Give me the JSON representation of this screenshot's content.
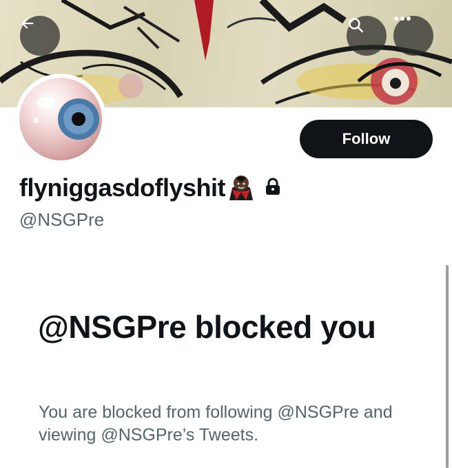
{
  "header": {
    "back_icon": "arrow-left-icon",
    "search_icon": "search-icon",
    "more_icon": "more-horizontal-icon"
  },
  "profile": {
    "follow_label": "Follow",
    "display_name": "flyniggasdoflyshit",
    "name_emoji": "🧛🏿‍♂️",
    "protected_icon": "lock-icon",
    "handle": "@NSGPre"
  },
  "blocked": {
    "title": "@NSGPre blocked you",
    "description": "You are blocked from following @NSGPre and viewing @NSGPre’s Tweets."
  },
  "colors": {
    "primary_text": "#0f1419",
    "secondary_text": "#536471",
    "follow_bg": "#0f1419"
  }
}
